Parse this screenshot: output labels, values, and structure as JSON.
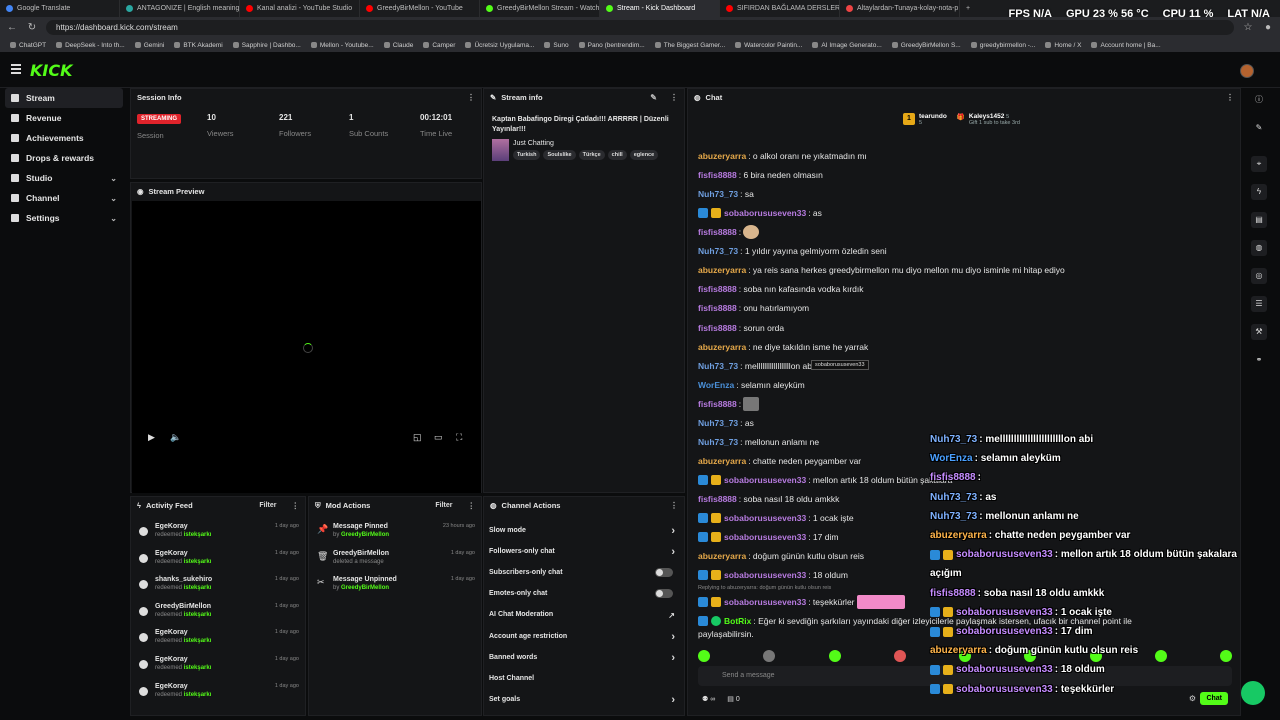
{
  "browser": {
    "tabs": [
      {
        "label": "Google Translate",
        "color": "#4285f4"
      },
      {
        "label": "ANTAGONIZE | English meaning -",
        "color": "#2aa7a1"
      },
      {
        "label": "Kanal analizi - YouTube Studio",
        "color": "#ff0000"
      },
      {
        "label": "GreedyBirMellon - YouTube",
        "color": "#ff0000"
      },
      {
        "label": "GreedyBirMellon Stream - Watch",
        "color": "#53fc18"
      },
      {
        "label": "Stream - Kick Dashboard",
        "color": "#53fc18",
        "active": true
      },
      {
        "label": "SIFIRDAN BAĞLAMA DERSLERİ 6 |",
        "color": "#ff0000"
      },
      {
        "label": "Altaylardan-Tunaya-kolay-nota-p",
        "color": "#e44"
      }
    ],
    "url": "https://dashboard.kick.com/stream",
    "bookmarks": [
      "ChatGPT",
      "DeepSeek - Into th...",
      "Gemini",
      "BTK Akademi",
      "Sapphire | Dashbo...",
      "Mellon - Youtube...",
      "Claude",
      "Camper",
      "Ücretsiz Uygulama...",
      "Suno",
      "Pano (bentrendim...",
      "The Biggest Gamer...",
      "Watercolor Paintin...",
      "AI Image Generato...",
      "GreedyBirMellon S...",
      "greedybirmellon -...",
      "Home / X",
      "Account home | Ba..."
    ]
  },
  "perf": {
    "fps_label": "FPS",
    "fps_value": "N/A",
    "gpu_label": "GPU",
    "gpu_value": "23 % 56 °C",
    "cpu_label": "CPU",
    "cpu_value": "11 %",
    "lat_label": "LAT",
    "lat_value": "N/A"
  },
  "app": {
    "logo": "KICK"
  },
  "sidebar": {
    "items": [
      {
        "label": "Stream",
        "active": true
      },
      {
        "label": "Revenue"
      },
      {
        "label": "Achievements"
      },
      {
        "label": "Drops & rewards"
      },
      {
        "label": "Studio",
        "chevron": true
      },
      {
        "label": "Channel",
        "chevron": true
      },
      {
        "label": "Settings",
        "chevron": true
      }
    ]
  },
  "session": {
    "title": "Session Info",
    "status": "STREAMING",
    "status_label": "Session",
    "stats": [
      {
        "value": "10",
        "label": "Viewers"
      },
      {
        "value": "221",
        "label": "Followers"
      },
      {
        "value": "1",
        "label": "Sub Counts"
      },
      {
        "value": "00:12:01",
        "label": "Time Live"
      }
    ]
  },
  "preview": {
    "title": "Stream Preview"
  },
  "stream_info": {
    "title": "Stream info",
    "stream_title": "Kaptan Babafingo Diregi Çatladı!!! ARRRRR | Düzenli Yayınlar!!!",
    "category": "Just Chatting",
    "tags": [
      "Turkish",
      "Soulslike",
      "Türkçe",
      "chill",
      "eglence"
    ]
  },
  "chat": {
    "title": "Chat",
    "leaders": [
      {
        "rank": "1",
        "name": "tearundo",
        "sub": "5"
      },
      {
        "name": "Kaleys1452",
        "sub": "5",
        "note": "Gift 1 sub to take 3rd"
      }
    ],
    "messages": [
      {
        "user": "abuzeryarra",
        "color": "#e6a94a",
        "text": ": o alkol oranı ne yıkatmadın mı"
      },
      {
        "user": "fisfis8888",
        "color": "#b77be0",
        "text": ": 6 bira neden olmasın"
      },
      {
        "user": "Nuh73_73",
        "color": "#6f9fe0",
        "text": ": sa"
      },
      {
        "user": "sobaborususeven33",
        "color": "#b77be0",
        "text": ": as",
        "badges": true
      },
      {
        "user": "fisfis8888",
        "color": "#b77be0",
        "text": ":",
        "emote": true
      },
      {
        "user": "Nuh73_73",
        "color": "#6f9fe0",
        "text": ": 1 yıldır yayına gelmiyorm özledin seni"
      },
      {
        "user": "abuzeryarra",
        "color": "#e6a94a",
        "text": ": ya reis sana herkes greedybirmellon mu diyo mellon mu diyo isminle mi hitap ediyo"
      },
      {
        "user": "fisfis8888",
        "color": "#b77be0",
        "text": ": soba nın kafasında vodka kırdık"
      },
      {
        "user": "fisfis8888",
        "color": "#b77be0",
        "text": ": onu hatırlamıyom"
      },
      {
        "user": "fisfis8888",
        "color": "#b77be0",
        "text": ": sorun orda"
      },
      {
        "user": "abuzeryarra",
        "color": "#e6a94a",
        "text": ": ne diye takıldın isme he yarrak"
      },
      {
        "user": "Nuh73_73",
        "color": "#6f9fe0",
        "text": ": mellllllllllllllllllon abi"
      },
      {
        "user": "WorEnza",
        "color": "#4a90d9",
        "text": ": selamın aleyküm"
      },
      {
        "user": "fisfis8888",
        "color": "#b77be0",
        "text": ":",
        "emote": true,
        "emote_gray": true
      },
      {
        "user": "Nuh73_73",
        "color": "#6f9fe0",
        "text": ": as"
      },
      {
        "user": "Nuh73_73",
        "color": "#6f9fe0",
        "text": ": mellonun anlamı ne"
      },
      {
        "user": "abuzeryarra",
        "color": "#e6a94a",
        "text": ": chatte neden peygamber var"
      },
      {
        "user": "sobaborususeven33",
        "color": "#b77be0",
        "text": ": mellon artık 18 oldum bütün şakalara",
        "badges": true
      },
      {
        "user": "fisfis8888",
        "color": "#b77be0",
        "text": ": soba nasıl 18 oldu amkkk"
      },
      {
        "user": "sobaborususeven33",
        "color": "#b77be0",
        "text": ": 1 ocak işte",
        "badges": true
      },
      {
        "user": "sobaborususeven33",
        "color": "#b77be0",
        "text": ": 17 dim",
        "badges": true
      },
      {
        "user": "abuzeryarra",
        "color": "#e6a94a",
        "text": ": doğum günün kutlu olsun reis"
      },
      {
        "user": "sobaborususeven33",
        "color": "#b77be0",
        "text": ": 18 oldum",
        "badges": true
      }
    ],
    "reply_context": "Replying to abuzeryarra: doğum günün kutlu olsun reis",
    "reply_message": {
      "user": "sobaborususeven33",
      "text": ": teşekkürler"
    },
    "bot_message": {
      "user": "BotRix",
      "text": ": Eğer ki sevdiğin şarkıları yayındaki diğer izleyicilerle paylaşmak istersen, ufacık bir channel point ile"
    },
    "bot_message_2": "paylaşabilirsin.",
    "tooltip": "sobaborususeven33",
    "input_placeholder": "Send a message",
    "points": "∞",
    "counter": "0",
    "send_label": "Chat"
  },
  "overlay": [
    {
      "user": "Nuh73_73",
      "color": "#7fb2ff",
      "text": " : melllllllllllllllllllllllon abi"
    },
    {
      "user": "WorEnza",
      "color": "#4aa0ff",
      "text": " : selamın aleyküm"
    },
    {
      "user": "fisfis8888",
      "color": "#c58cff",
      "text": " :"
    },
    {
      "user": "Nuh73_73",
      "color": "#7fb2ff",
      "text": " : as"
    },
    {
      "user": "Nuh73_73",
      "color": "#7fb2ff",
      "text": " : mellonun anlamı ne"
    },
    {
      "user": "abuzeryarra",
      "color": "#ffb44a",
      "text": " : chatte neden peygamber var"
    },
    {
      "user": "sobaborususeven33",
      "color": "#c58cff",
      "text": " : mellon artık 18 oldum bütün şakalara",
      "badges": true
    },
    {
      "user": "",
      "color": "#fff",
      "text": "açığım"
    },
    {
      "user": "fisfis8888",
      "color": "#c58cff",
      "text": " : soba nasıl 18 oldu amkkk"
    },
    {
      "user": "sobaborususeven33",
      "color": "#c58cff",
      "text": " : 1 ocak işte",
      "badges": true
    },
    {
      "user": "sobaborususeven33",
      "color": "#c58cff",
      "text": " : 17 dim",
      "badges": true
    },
    {
      "user": "abuzeryarra",
      "color": "#ffb44a",
      "text": " : doğum günün kutlu olsun reis"
    },
    {
      "user": "sobaborususeven33",
      "color": "#c58cff",
      "text": " : 18 oldum",
      "badges": true
    },
    {
      "user": "sobaborususeven33",
      "color": "#c58cff",
      "text": " : teşekkürler",
      "badges": true
    }
  ],
  "activity": {
    "title": "Activity Feed",
    "filter": "Filter",
    "items": [
      {
        "name": "EgeKoray",
        "action": "redeemed",
        "reward": "istekşarkı",
        "ago": "1 day ago"
      },
      {
        "name": "EgeKoray",
        "action": "redeemed",
        "reward": "istekşarkı",
        "ago": "1 day ago"
      },
      {
        "name": "shanks_sukehiro",
        "action": "redeemed",
        "reward": "istekşarkı",
        "ago": "1 day ago"
      },
      {
        "name": "GreedyBirMellon",
        "action": "redeemed",
        "reward": "istekşarkı",
        "ago": "1 day ago"
      },
      {
        "name": "EgeKoray",
        "action": "redeemed",
        "reward": "istekşarkı",
        "ago": "1 day ago"
      },
      {
        "name": "EgeKoray",
        "action": "redeemed",
        "reward": "istekşarkı",
        "ago": "1 day ago"
      },
      {
        "name": "EgeKoray",
        "action": "redeemed",
        "reward": "istekşarkı",
        "ago": "1 day ago"
      }
    ]
  },
  "mod_actions": {
    "title": "Mod Actions",
    "filter": "Filter",
    "items": [
      {
        "name": "Message Pinned",
        "by": "by",
        "who": "GreedyBirMellon",
        "ago": "23 hours ago"
      },
      {
        "name": "GreedyBirMellon",
        "by": "deleted a message",
        "who": "",
        "ago": "1 day ago"
      },
      {
        "name": "Message Unpinned",
        "by": "by",
        "who": "GreedyBirMellon",
        "ago": "1 day ago"
      }
    ]
  },
  "channel_actions": {
    "title": "Channel Actions",
    "items": [
      {
        "label": "Slow mode",
        "kind": "arrow"
      },
      {
        "label": "Followers-only chat",
        "kind": "arrow"
      },
      {
        "label": "Subscribers-only chat",
        "kind": "toggle"
      },
      {
        "label": "Emotes-only chat",
        "kind": "toggle"
      },
      {
        "label": "AI Chat Moderation",
        "kind": "ext"
      },
      {
        "label": "Account age restriction",
        "kind": "arrow"
      },
      {
        "label": "Banned words",
        "kind": "arrow"
      },
      {
        "label": "Host Channel",
        "kind": "none"
      },
      {
        "label": "Set goals",
        "kind": "arrow"
      }
    ]
  },
  "colors": {
    "accent": "#53fc18",
    "live": "#e0232b"
  }
}
